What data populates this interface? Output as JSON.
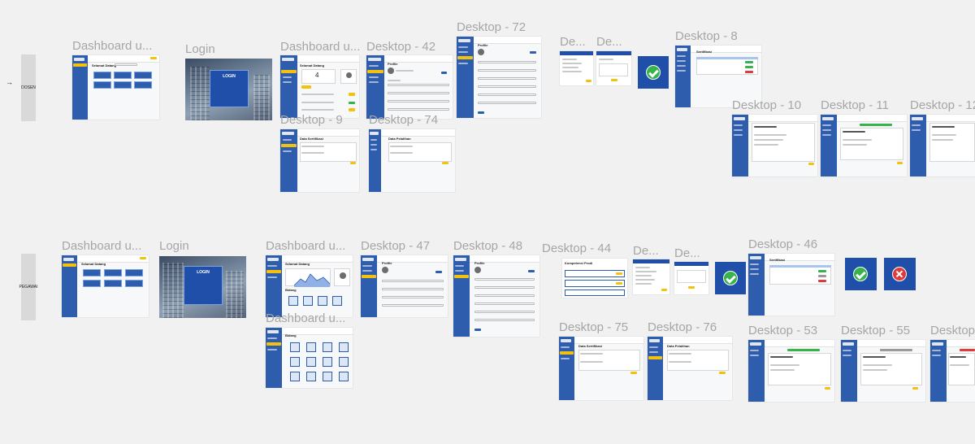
{
  "row_tags": {
    "dosen": "DOSEN",
    "pegawai": "PEGAWAI"
  },
  "frames_top": {
    "dash1": "Dashboard u...",
    "login1": "Login",
    "dash2": "Dashboard u...",
    "d42": "Desktop - 42",
    "d72": "Desktop - 72",
    "de1": "De...",
    "de2": "De...",
    "d8": "Desktop - 8",
    "d9": "Desktop - 9",
    "d74": "Desktop - 74",
    "d10": "Desktop - 10",
    "d11": "Desktop - 11",
    "d12": "Desktop - 12"
  },
  "frames_bottom": {
    "dash1": "Dashboard u...",
    "login1": "Login",
    "dash2": "Dashboard u...",
    "dash3": "Dashboard u...",
    "d47": "Desktop - 47",
    "d48": "Desktop - 48",
    "d44": "Desktop - 44",
    "de1": "De...",
    "de2": "De...",
    "d46": "Desktop - 46",
    "d75": "Desktop - 75",
    "d76": "Desktop - 76",
    "d53": "Desktop - 53",
    "d55": "Desktop - 55",
    "dlast": "Desktop"
  },
  "mini_text": {
    "welcome": "Selamat Datang",
    "login": "LOGIN",
    "profile": "Profile",
    "data_sertifikasi": "Data Sertifikasi",
    "data_pelatihan": "Data Pelatihan",
    "sertifikasi": "Sertifikasi",
    "bidang": "Bidang",
    "kompetensi_prodi": "Kompetensi Prodi",
    "count": "4"
  },
  "colors": {
    "canvas": "#f1f1f1",
    "sidebar": "#2f5dae",
    "accent": "#f4c20d",
    "success": "#36b34a",
    "danger": "#e03b3b",
    "label": "#a6a6a6"
  }
}
